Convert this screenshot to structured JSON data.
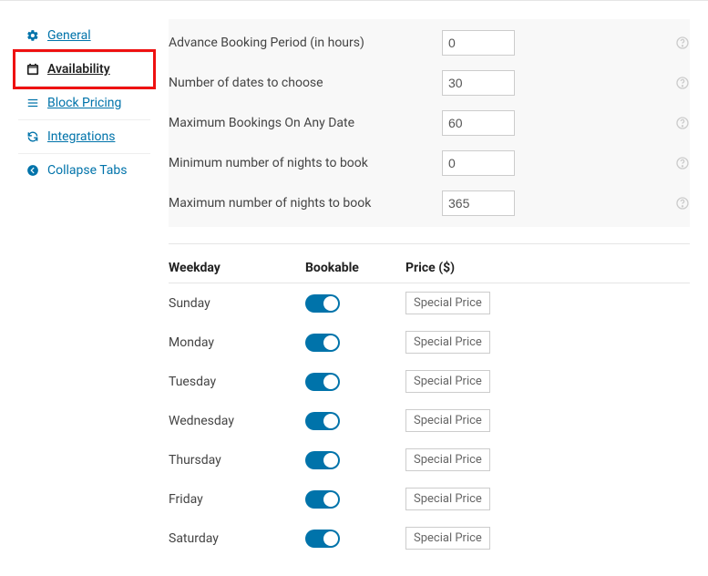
{
  "sidebar": {
    "items": [
      {
        "label": "General"
      },
      {
        "label": "Availability"
      },
      {
        "label": "Block Pricing"
      },
      {
        "label": "Integrations"
      },
      {
        "label": "Collapse Tabs"
      }
    ]
  },
  "settings": {
    "rows": [
      {
        "label": "Advance Booking Period (in hours)",
        "value": "0"
      },
      {
        "label": "Number of dates to choose",
        "value": "30"
      },
      {
        "label": "Maximum Bookings On Any Date",
        "value": "60"
      },
      {
        "label": "Minimum number of nights to book",
        "value": "0"
      },
      {
        "label": "Maximum number of nights to book",
        "value": "365"
      }
    ]
  },
  "weekdays": {
    "headers": {
      "day": "Weekday",
      "bookable": "Bookable",
      "price": "Price ($)"
    },
    "rows": [
      {
        "name": "Sunday",
        "bookable": true,
        "price_label": "Special Price"
      },
      {
        "name": "Monday",
        "bookable": true,
        "price_label": "Special Price"
      },
      {
        "name": "Tuesday",
        "bookable": true,
        "price_label": "Special Price"
      },
      {
        "name": "Wednesday",
        "bookable": true,
        "price_label": "Special Price"
      },
      {
        "name": "Thursday",
        "bookable": true,
        "price_label": "Special Price"
      },
      {
        "name": "Friday",
        "bookable": true,
        "price_label": "Special Price"
      },
      {
        "name": "Saturday",
        "bookable": true,
        "price_label": "Special Price"
      }
    ]
  }
}
